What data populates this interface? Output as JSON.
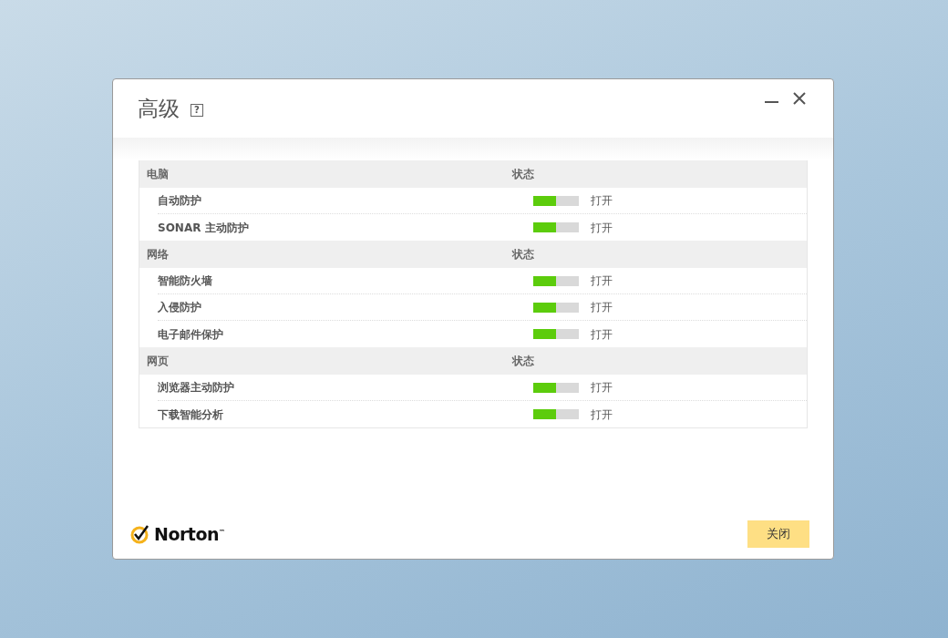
{
  "window": {
    "title": "高级",
    "help": "?"
  },
  "sections": [
    {
      "name": "电脑",
      "status_heading": "状态",
      "items": [
        {
          "name": "自动防护",
          "on": true,
          "state": "打开"
        },
        {
          "name": "SONAR 主动防护",
          "on": true,
          "state": "打开"
        }
      ]
    },
    {
      "name": "网络",
      "status_heading": "状态",
      "items": [
        {
          "name": "智能防火墙",
          "on": true,
          "state": "打开"
        },
        {
          "name": "入侵防护",
          "on": true,
          "state": "打开"
        },
        {
          "name": "电子邮件保护",
          "on": true,
          "state": "打开"
        }
      ]
    },
    {
      "name": "网页",
      "status_heading": "状态",
      "items": [
        {
          "name": "浏览器主动防护",
          "on": true,
          "state": "打开"
        },
        {
          "name": "下载智能分析",
          "on": true,
          "state": "打开"
        }
      ]
    }
  ],
  "footer": {
    "logo_text": "Norton",
    "logo_mark": "™",
    "close_button": "关闭"
  }
}
